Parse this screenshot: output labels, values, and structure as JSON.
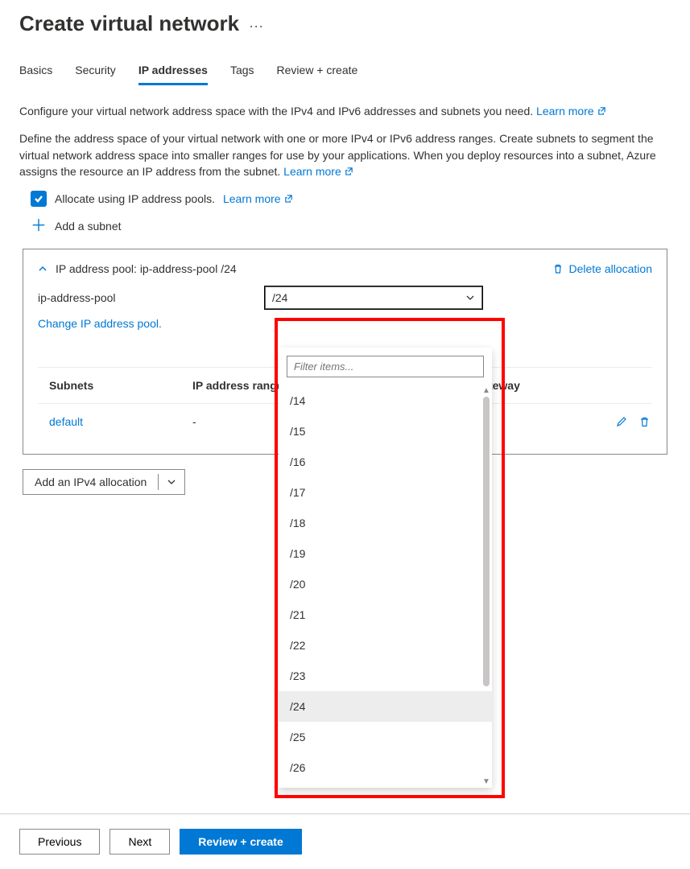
{
  "header": {
    "title": "Create virtual network"
  },
  "tabs": [
    "Basics",
    "Security",
    "IP addresses",
    "Tags",
    "Review + create"
  ],
  "activeTab": "IP addresses",
  "intro": {
    "line1": "Configure your virtual network address space with the IPv4 and IPv6 addresses and subnets you need.",
    "learn1": "Learn more",
    "line2": "Define the address space of your virtual network with one or more IPv4 or IPv6 address ranges. Create subnets to segment the virtual network address space into smaller ranges for use by your applications. When you deploy resources into a subnet, Azure assigns the resource an IP address from the subnet.",
    "learn2": "Learn more"
  },
  "allocate": {
    "label": "Allocate using IP address pools.",
    "learn": "Learn more"
  },
  "addSubnet": "Add a subnet",
  "pool": {
    "headerPrefix": "IP address pool:",
    "name": "ip-address-pool",
    "cidrShort": "/24",
    "deleteLabel": "Delete allocation",
    "changeLabel": "Change IP address pool.",
    "dropdownSelected": "/24"
  },
  "subnetTable": {
    "cols": {
      "name": "Subnets",
      "ip": "IP address range",
      "nat": "NAT gateway"
    },
    "row": {
      "name": "default",
      "ip": "-",
      "nat": ""
    }
  },
  "addAllocation": "Add an IPv4 allocation",
  "dropdown": {
    "filterPlaceholder": "Filter items...",
    "options": [
      "/14",
      "/15",
      "/16",
      "/17",
      "/18",
      "/19",
      "/20",
      "/21",
      "/22",
      "/23",
      "/24",
      "/25",
      "/26"
    ],
    "selected": "/24"
  },
  "footer": {
    "previous": "Previous",
    "next": "Next",
    "review": "Review + create"
  }
}
